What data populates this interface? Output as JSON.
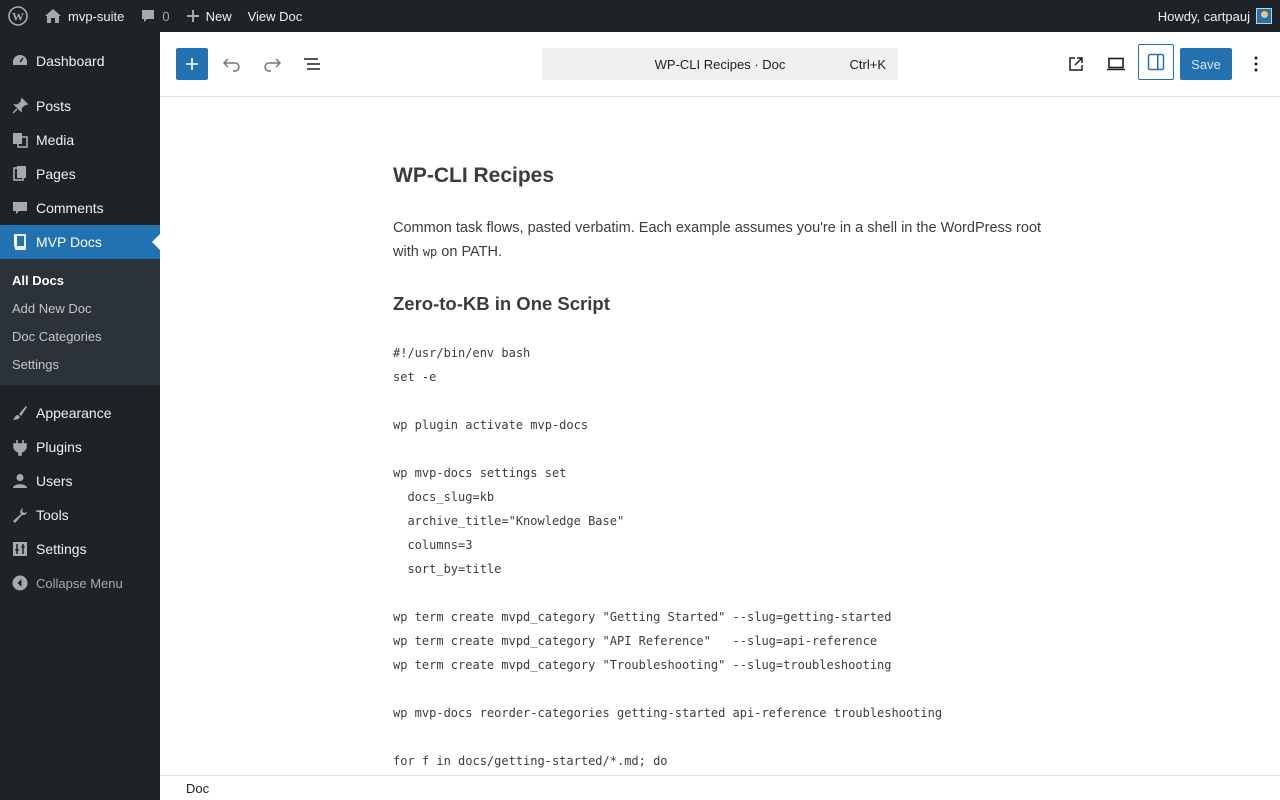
{
  "adminbar": {
    "site_name": "mvp-suite",
    "comments_count": "0",
    "new_label": "New",
    "view_label": "View Doc",
    "howdy": "Howdy, cartpauj"
  },
  "sidebar": {
    "items": [
      {
        "label": "Dashboard",
        "icon": "dashboard-icon"
      },
      {
        "label": "Posts",
        "icon": "pin-icon"
      },
      {
        "label": "Media",
        "icon": "media-icon"
      },
      {
        "label": "Pages",
        "icon": "pages-icon"
      },
      {
        "label": "Comments",
        "icon": "comment-icon"
      },
      {
        "label": "MVP Docs",
        "icon": "book-icon"
      },
      {
        "label": "Appearance",
        "icon": "brush-icon"
      },
      {
        "label": "Plugins",
        "icon": "plugin-icon"
      },
      {
        "label": "Users",
        "icon": "user-icon"
      },
      {
        "label": "Tools",
        "icon": "wrench-icon"
      },
      {
        "label": "Settings",
        "icon": "sliders-icon"
      }
    ],
    "submenu": [
      "All Docs",
      "Add New Doc",
      "Doc Categories",
      "Settings"
    ],
    "collapse_label": "Collapse Menu"
  },
  "header": {
    "command_title": "WP-CLI Recipes · Doc",
    "command_shortcut": "Ctrl+K",
    "save_label": "Save"
  },
  "doc": {
    "title": "WP-CLI Recipes",
    "intro_before": "Common task flows, pasted verbatim. Each example assumes you're in a shell in the WordPress root with ",
    "intro_code": "wp",
    "intro_after": " on PATH.",
    "section_heading": "Zero-to-KB in One Script",
    "code": "#!/usr/bin/env bash\nset -e\n\nwp plugin activate mvp-docs\n\nwp mvp-docs settings set\n  docs_slug=kb\n  archive_title=\"Knowledge Base\"\n  columns=3\n  sort_by=title\n\nwp term create mvpd_category \"Getting Started\" --slug=getting-started\nwp term create mvpd_category \"API Reference\"   --slug=api-reference\nwp term create mvpd_category \"Troubleshooting\" --slug=troubleshooting\n\nwp mvp-docs reorder-categories getting-started api-reference troubleshooting\n\nfor f in docs/getting-started/*.md; do"
  },
  "footer": {
    "breadcrumb": "Doc"
  },
  "colors": {
    "admin_dark": "#1d2327",
    "accent": "#2271b1"
  }
}
